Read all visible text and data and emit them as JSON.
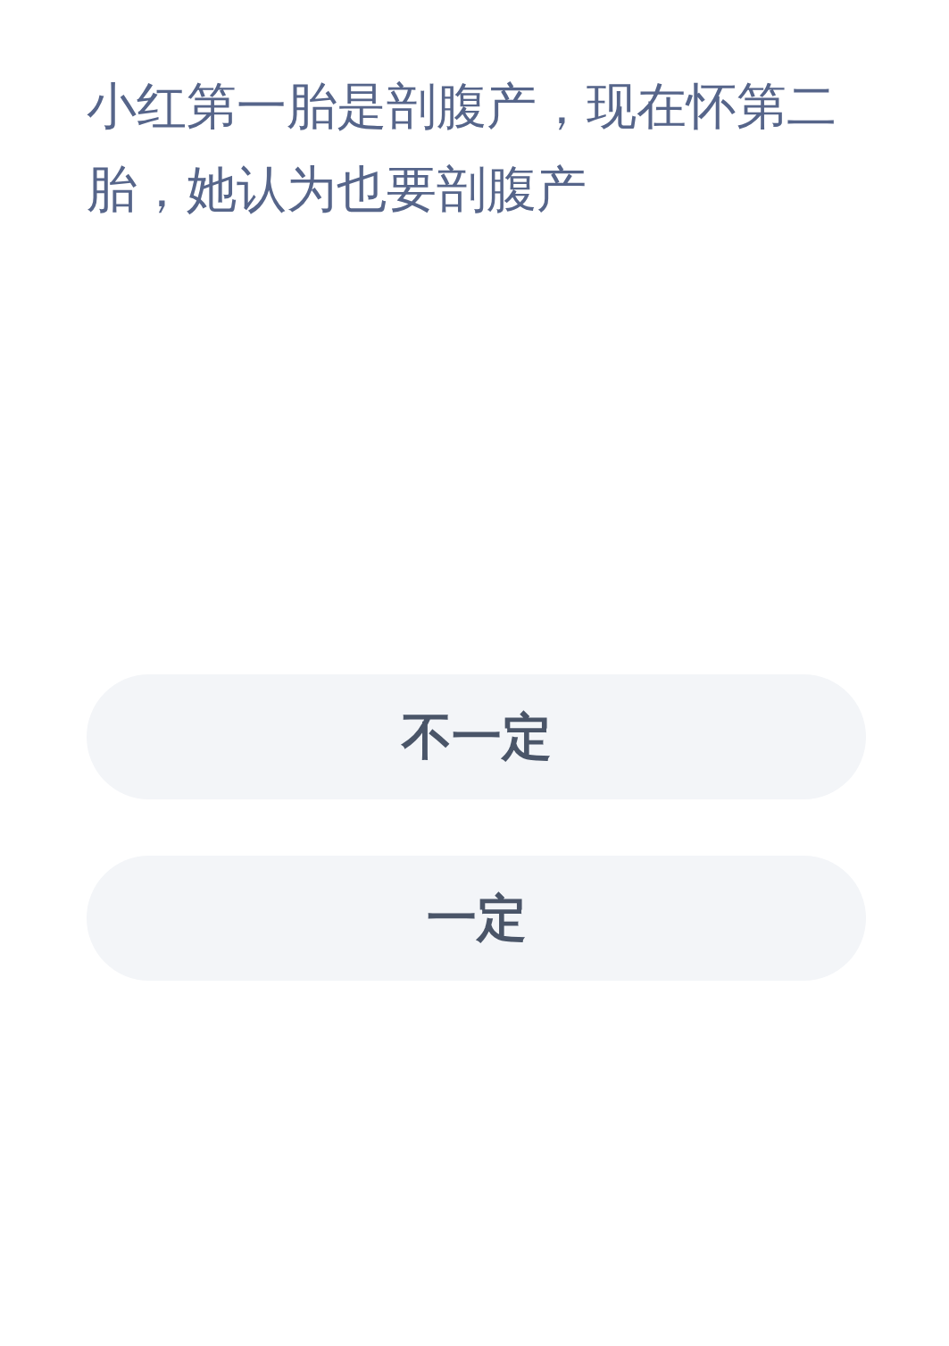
{
  "question": "小红第一胎是剖腹产，现在怀第二胎，她认为也要剖腹产",
  "options": [
    {
      "label": "不一定"
    },
    {
      "label": "一定"
    }
  ]
}
